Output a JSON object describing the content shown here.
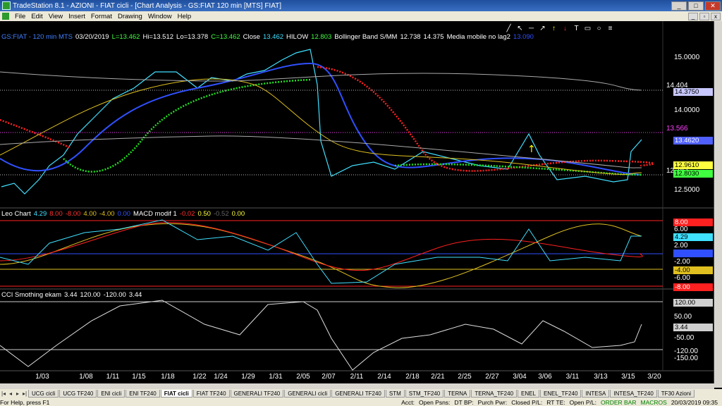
{
  "window": {
    "title": "TradeStation 8.1 - AZIONI - FIAT cicli - [Chart Analysis - GS:FIAT  120 min  [MTS] FIAT]",
    "minimize": "_",
    "maximize": "□",
    "close": "✕"
  },
  "menu": {
    "items": [
      "File",
      "Edit",
      "View",
      "Insert",
      "Format",
      "Drawing",
      "Window",
      "Help"
    ],
    "min": "_",
    "restore": "▫",
    "close": "x"
  },
  "toolbar_icons": [
    "line-tool-icon",
    "cursor-icon",
    "horizontal-line-icon",
    "arrow-tool-icon",
    "arrow-up-icon",
    "arrow-down-icon",
    "text-tool-icon",
    "rectangle-tool-icon",
    "circle-tool-icon",
    "fibonacci-icon"
  ],
  "toolbar_glyphs": [
    "╱",
    "↖",
    "─",
    "↗",
    "↑",
    "↓",
    "T",
    "▭",
    "○",
    "≡"
  ],
  "price_panel": {
    "symbol": "GS:FIAT - 120 min  MTS",
    "date": "03/20/2019",
    "low_label": "L=13.462",
    "hi_label": "Hi=13.512",
    "lo_label": "Lo=13.378",
    "close_label": "C=13.462",
    "close_word": "Close",
    "close_val": "13.462",
    "hilow": "HILOW",
    "hilow_val": "12.803",
    "bb_label": "Bollinger Band S/MM",
    "bb_val1": "12.738",
    "bb_val2": "14.375",
    "ma_label": "Media mobile no lag2",
    "ma_val": "13.090",
    "axis_labels": [
      "15.0000",
      "14.0000",
      "12.5000"
    ],
    "line_label_1": "14.404",
    "line_label_2": "13.566",
    "line_label_3": "12.782",
    "box_1": "14.3750",
    "box_2": "13.4620",
    "box_3": "12.9610",
    "box_4": "12.8030",
    "colors": {
      "up": "#ff2020",
      "blue": "#3050ff",
      "green": "#20e020",
      "yellow": "#e0c020",
      "cyan": "#40e0ff",
      "magenta": "#ff40ff"
    }
  },
  "leo_panel": {
    "name": "Leo Chart",
    "v1": "4.29",
    "v2": "8.00",
    "v3": "-8.00",
    "v4": "4.00",
    "v5": "-4.00",
    "v6": "0.00",
    "macd": "MACD modif 1",
    "m1": "-0.02",
    "m2": "0.50",
    "m3": "-0.52",
    "m4": "0.00",
    "axis": {
      "a8": "8.00",
      "a6": "6.00",
      "a4": "4.29",
      "a2": "2.00",
      "a0": "0.00",
      "am2": "-2.00",
      "am4": "-4.00",
      "am6": "-6.00",
      "am8": "-8.00"
    }
  },
  "cci_panel": {
    "name": "CCI Smothing ekam",
    "v1": "3.44",
    "v2": "120.00",
    "v3": "-120.00",
    "v4": "3.44",
    "axis": {
      "a120": "120.00",
      "a50": "50.00",
      "a3": "3.44",
      "am50": "-50.00",
      "am120": "-120.00",
      "am150": "-150.00"
    }
  },
  "x_axis": [
    "1/03",
    "1/08",
    "1/11",
    "1/15",
    "1/18",
    "1/22",
    "1/24",
    "1/29",
    "1/31",
    "2/05",
    "2/07",
    "2/11",
    "2/14",
    "2/18",
    "2/21",
    "2/25",
    "2/27",
    "3/04",
    "3/06",
    "3/11",
    "3/13",
    "3/15",
    "3/20"
  ],
  "tabs": [
    "UCG cicli",
    "UCG TF240",
    "ENI cicli",
    "ENI TF240",
    "FIAT cicli",
    "FIAT TF240",
    "GENERALI TF240",
    "GENERALI cicli",
    "GENERALI TF240",
    "STM",
    "STM_TF240",
    "TERNA",
    "TERNA_TF240",
    "ENEL",
    "ENEL_TF240",
    "INTESA",
    "INTESA_TF240",
    "TF30 Azioni"
  ],
  "status": {
    "help": "For Help, press F1",
    "acct": "Acct:",
    "open_psns": "Open Psns:",
    "dt_bp": "DT BP:",
    "purch_pwr": "Purch Pwr:",
    "closed_pl": "Closed P/L:",
    "rt_te": "RT TE:",
    "open_pl": "Open P/L:",
    "order_bar": "ORDER BAR",
    "macros": "MACROS",
    "datetime": "20/03/2019 09:35"
  }
}
